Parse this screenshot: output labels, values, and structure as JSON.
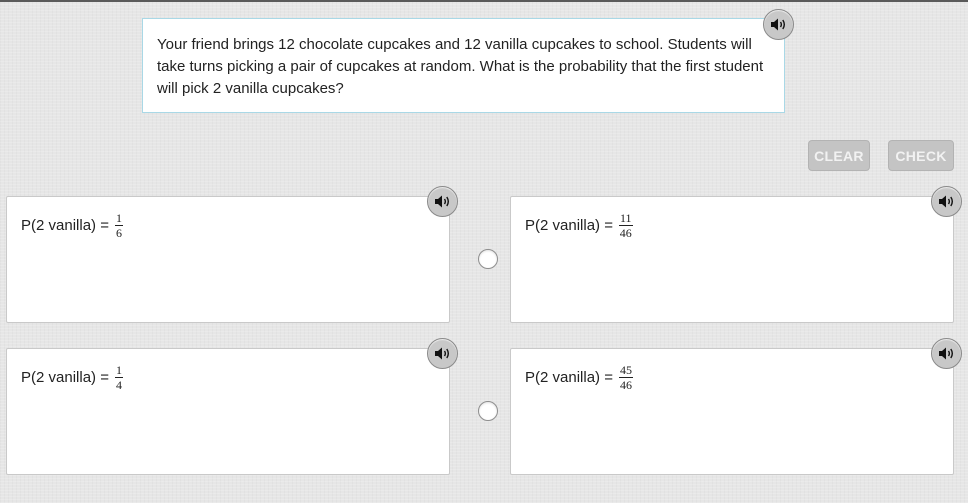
{
  "question": {
    "text": "Your friend brings 12 chocolate cupcakes and 12 vanilla cupcakes to school. Students will take turns picking a pair of cupcakes at random. What is the probability that the first student will pick 2 vanilla cupcakes?",
    "audio_icon": "speaker-icon"
  },
  "actions": {
    "clear_label": "CLEAR",
    "check_label": "CHECK"
  },
  "choices": [
    {
      "prefix": "P(2 vanilla) =",
      "numerator": "1",
      "denominator": "6",
      "audio_icon": "speaker-icon"
    },
    {
      "prefix": "P(2 vanilla) =",
      "numerator": "11",
      "denominator": "46",
      "audio_icon": "speaker-icon"
    },
    {
      "prefix": "P(2 vanilla) =",
      "numerator": "1",
      "denominator": "4",
      "audio_icon": "speaker-icon"
    },
    {
      "prefix": "P(2 vanilla) =",
      "numerator": "45",
      "denominator": "46",
      "audio_icon": "speaker-icon"
    }
  ],
  "colors": {
    "background": "#e6e6e6",
    "question_border": "#a9d8e6",
    "disabled_button": "#c4c4c4"
  }
}
